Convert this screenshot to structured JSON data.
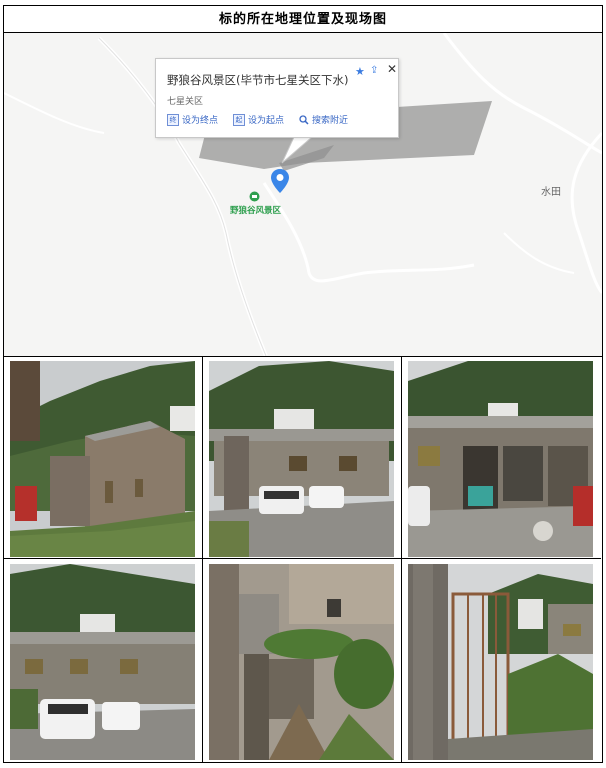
{
  "title": "标的所在地理位置及现场图",
  "map": {
    "popup": {
      "title": "野狼谷风景区(毕节市七星关区下水)",
      "subtitle": "七星关区",
      "actions": [
        {
          "icon": "终",
          "label": "设为终点"
        },
        {
          "icon": "起",
          "label": "设为起点"
        },
        {
          "icon": "search-icon",
          "label": "搜索附近"
        }
      ]
    },
    "poi_label": "野狼谷风景区",
    "town_label": "水田"
  },
  "colors": {
    "pin": "#3a86e8",
    "poi": "#2e9f4e",
    "link": "#3a68c5"
  },
  "photos": [
    {
      "scene": "stone house on hillside"
    },
    {
      "scene": "building with white SUV and car"
    },
    {
      "scene": "facility with open bays"
    },
    {
      "scene": "row building with parked cars"
    },
    {
      "scene": "vine-covered ruined wall"
    },
    {
      "scene": "rusty gate and stone pillar"
    }
  ]
}
